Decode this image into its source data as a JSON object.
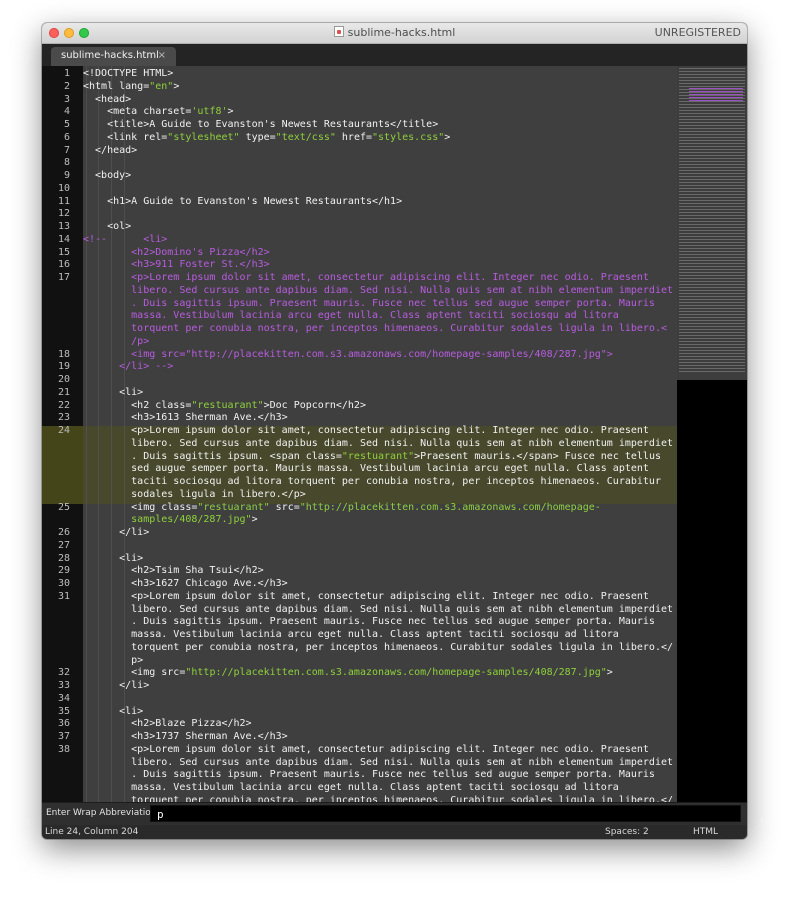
{
  "window": {
    "title": "sublime-hacks.html",
    "registration": "UNREGISTERED"
  },
  "tab": {
    "label": "sublime-hacks.html",
    "close": "×"
  },
  "lines": [
    {
      "n": "1",
      "s": [
        [
          "t",
          "<!DOCTYPE HTML>"
        ]
      ]
    },
    {
      "n": "2",
      "s": [
        [
          "t",
          "<html lang="
        ],
        [
          "s",
          "\"en\""
        ],
        [
          "t",
          ">"
        ]
      ]
    },
    {
      "n": "3",
      "s": [
        [
          "t",
          "  <head>"
        ]
      ]
    },
    {
      "n": "4",
      "s": [
        [
          "t",
          "    <meta charset="
        ],
        [
          "s",
          "'utf8'"
        ],
        [
          "t",
          ">"
        ]
      ]
    },
    {
      "n": "5",
      "s": [
        [
          "t",
          "    <title>A Guide to Evanston's Newest Restaurants</title>"
        ]
      ]
    },
    {
      "n": "6",
      "s": [
        [
          "t",
          "    <link rel="
        ],
        [
          "s",
          "\"stylesheet\""
        ],
        [
          "t",
          " type="
        ],
        [
          "s",
          "\"text/css\""
        ],
        [
          "t",
          " href="
        ],
        [
          "s",
          "\"styles.css\""
        ],
        [
          "t",
          ">"
        ]
      ]
    },
    {
      "n": "7",
      "s": [
        [
          "t",
          "  </head>"
        ]
      ]
    },
    {
      "n": "8",
      "s": [
        [
          "t",
          ""
        ]
      ]
    },
    {
      "n": "9",
      "s": [
        [
          "t",
          "  <body>"
        ]
      ]
    },
    {
      "n": "10",
      "s": [
        [
          "t",
          ""
        ]
      ]
    },
    {
      "n": "11",
      "s": [
        [
          "t",
          "    <h1>A Guide to Evanston's Newest Restaurants</h1>"
        ]
      ]
    },
    {
      "n": "12",
      "s": [
        [
          "t",
          ""
        ]
      ]
    },
    {
      "n": "13",
      "s": [
        [
          "t",
          "    <ol>"
        ]
      ]
    },
    {
      "n": "14",
      "s": [
        [
          "c",
          "<!--      <li>"
        ]
      ]
    },
    {
      "n": "15",
      "s": [
        [
          "c",
          "        <h2>Domino's Pizza</h2>"
        ]
      ]
    },
    {
      "n": "16",
      "s": [
        [
          "c",
          "        <h3>911 Foster St.</h3>"
        ]
      ]
    },
    {
      "n": "17",
      "s": [
        [
          "c",
          "        <p>Lorem ipsum dolor sit amet, consectetur adipiscing elit. Integer nec odio. Praesent"
        ]
      ]
    },
    {
      "n": "",
      "s": [
        [
          "c",
          "        libero. Sed cursus ante dapibus diam. Sed nisi. Nulla quis sem at nibh elementum imperdiet"
        ]
      ]
    },
    {
      "n": "",
      "s": [
        [
          "c",
          "        . Duis sagittis ipsum. Praesent mauris. Fusce nec tellus sed augue semper porta. Mauris"
        ]
      ]
    },
    {
      "n": "",
      "s": [
        [
          "c",
          "        massa. Vestibulum lacinia arcu eget nulla. Class aptent taciti sociosqu ad litora"
        ]
      ]
    },
    {
      "n": "",
      "s": [
        [
          "c",
          "        torquent per conubia nostra, per inceptos himenaeos. Curabitur sodales ligula in libero.<"
        ]
      ]
    },
    {
      "n": "",
      "s": [
        [
          "c",
          "        /p>"
        ]
      ]
    },
    {
      "n": "18",
      "s": [
        [
          "c",
          "        <img src=\"http://placekitten.com.s3.amazonaws.com/homepage-samples/408/287.jpg\">"
        ]
      ]
    },
    {
      "n": "19",
      "s": [
        [
          "c",
          "      </li> -->"
        ]
      ]
    },
    {
      "n": "20",
      "s": [
        [
          "t",
          ""
        ]
      ]
    },
    {
      "n": "21",
      "s": [
        [
          "t",
          "      <li>"
        ]
      ]
    },
    {
      "n": "22",
      "s": [
        [
          "t",
          "        <h2 class="
        ],
        [
          "s",
          "\"restuarant\""
        ],
        [
          "t",
          ">Doc Popcorn</h2>"
        ]
      ]
    },
    {
      "n": "23",
      "s": [
        [
          "t",
          "        <h3>1613 Sherman Ave.</h3>"
        ]
      ]
    },
    {
      "n": "24",
      "s": [
        [
          "t",
          "        <p>Lorem ipsum dolor sit amet, consectetur adipiscing elit. Integer nec odio. Praesent"
        ]
      ]
    },
    {
      "n": "",
      "s": [
        [
          "t",
          "        libero. Sed cursus ante dapibus diam. Sed nisi. Nulla quis sem at nibh elementum imperdiet"
        ]
      ]
    },
    {
      "n": "",
      "s": [
        [
          "t",
          "        . Duis sagittis ipsum. <span class="
        ],
        [
          "s",
          "\"restuarant\""
        ],
        [
          "t",
          ">Praesent mauris.</span> Fusce nec tellus"
        ]
      ]
    },
    {
      "n": "",
      "s": [
        [
          "t",
          "        sed augue semper porta. Mauris massa. Vestibulum lacinia arcu eget nulla. Class aptent"
        ]
      ]
    },
    {
      "n": "",
      "s": [
        [
          "t",
          "        taciti sociosqu ad litora torquent per conubia nostra, per inceptos himenaeos. Curabitur"
        ]
      ]
    },
    {
      "n": "",
      "s": [
        [
          "t",
          "        sodales ligula in libero.</p>"
        ]
      ]
    },
    {
      "n": "25",
      "s": [
        [
          "t",
          "        <img class="
        ],
        [
          "s",
          "\"restuarant\""
        ],
        [
          "t",
          " src="
        ],
        [
          "s",
          "\"http://placekitten.com.s3.amazonaws.com/homepage-"
        ]
      ]
    },
    {
      "n": "",
      "s": [
        [
          "s",
          "        samples/408/287.jpg\""
        ],
        [
          "t",
          ">"
        ]
      ]
    },
    {
      "n": "26",
      "s": [
        [
          "t",
          "      </li>"
        ]
      ]
    },
    {
      "n": "27",
      "s": [
        [
          "t",
          ""
        ]
      ]
    },
    {
      "n": "28",
      "s": [
        [
          "t",
          "      <li>"
        ]
      ]
    },
    {
      "n": "29",
      "s": [
        [
          "t",
          "        <h2>Tsim Sha Tsui</h2>"
        ]
      ]
    },
    {
      "n": "30",
      "s": [
        [
          "t",
          "        <h3>1627 Chicago Ave.</h3>"
        ]
      ]
    },
    {
      "n": "31",
      "s": [
        [
          "t",
          "        <p>Lorem ipsum dolor sit amet, consectetur adipiscing elit. Integer nec odio. Praesent"
        ]
      ]
    },
    {
      "n": "",
      "s": [
        [
          "t",
          "        libero. Sed cursus ante dapibus diam. Sed nisi. Nulla quis sem at nibh elementum imperdiet"
        ]
      ]
    },
    {
      "n": "",
      "s": [
        [
          "t",
          "        . Duis sagittis ipsum. Praesent mauris. Fusce nec tellus sed augue semper porta. Mauris"
        ]
      ]
    },
    {
      "n": "",
      "s": [
        [
          "t",
          "        massa. Vestibulum lacinia arcu eget nulla. Class aptent taciti sociosqu ad litora"
        ]
      ]
    },
    {
      "n": "",
      "s": [
        [
          "t",
          "        torquent per conubia nostra, per inceptos himenaeos. Curabitur sodales ligula in libero.</"
        ]
      ]
    },
    {
      "n": "",
      "s": [
        [
          "t",
          "        p>"
        ]
      ]
    },
    {
      "n": "32",
      "s": [
        [
          "t",
          "        <img src="
        ],
        [
          "s",
          "\"http://placekitten.com.s3.amazonaws.com/homepage-samples/408/287.jpg\""
        ],
        [
          "t",
          ">"
        ]
      ]
    },
    {
      "n": "33",
      "s": [
        [
          "t",
          "      </li>"
        ]
      ]
    },
    {
      "n": "34",
      "s": [
        [
          "t",
          ""
        ]
      ]
    },
    {
      "n": "35",
      "s": [
        [
          "t",
          "      <li>"
        ]
      ]
    },
    {
      "n": "36",
      "s": [
        [
          "t",
          "        <h2>Blaze Pizza</h2>"
        ]
      ]
    },
    {
      "n": "37",
      "s": [
        [
          "t",
          "        <h3>1737 Sherman Ave.</h3>"
        ]
      ]
    },
    {
      "n": "38",
      "s": [
        [
          "t",
          "        <p>Lorem ipsum dolor sit amet, consectetur adipiscing elit. Integer nec odio. Praesent"
        ]
      ]
    },
    {
      "n": "",
      "s": [
        [
          "t",
          "        libero. Sed cursus ante dapibus diam. Sed nisi. Nulla quis sem at nibh elementum imperdiet"
        ]
      ]
    },
    {
      "n": "",
      "s": [
        [
          "t",
          "        . Duis sagittis ipsum. Praesent mauris. Fusce nec tellus sed augue semper porta. Mauris"
        ]
      ]
    },
    {
      "n": "",
      "s": [
        [
          "t",
          "        massa. Vestibulum lacinia arcu eget nulla. Class aptent taciti sociosqu ad litora"
        ]
      ]
    },
    {
      "n": "",
      "s": [
        [
          "t",
          "        torquent per conubia nostra, per inceptos himenaeos. Curabitur sodales ligula in libero.</"
        ]
      ]
    }
  ],
  "panel": {
    "label": "Enter Wrap Abbreviation:",
    "value": "p"
  },
  "status": {
    "position": "Line 24, Column 204",
    "spaces": "Spaces: 2",
    "syntax": "HTML"
  },
  "colors": {
    "text": "#f1f1f1",
    "string": "#8fd13b",
    "comment": "#b85ce0",
    "background": "#3f3f3f"
  }
}
